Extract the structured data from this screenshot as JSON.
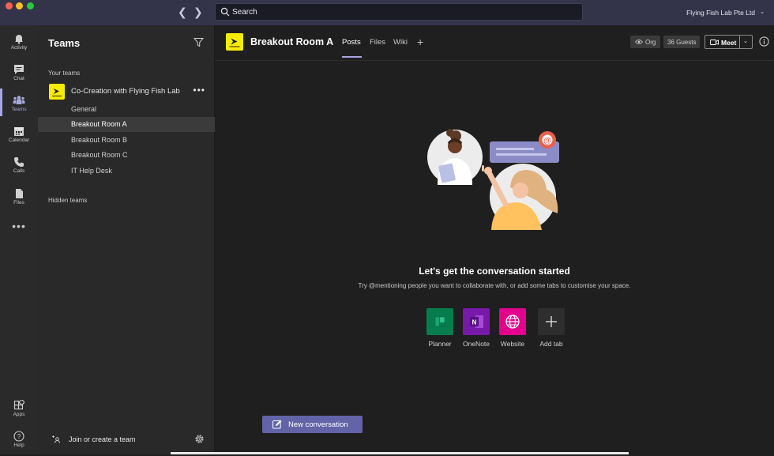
{
  "window": {
    "search_placeholder": "Search",
    "org_name": "Flying Fish Lab Pte Ltd",
    "org_chevron": "⌄"
  },
  "rail": {
    "items": [
      {
        "label": "Activity"
      },
      {
        "label": "Chat"
      },
      {
        "label": "Teams"
      },
      {
        "label": "Calendar"
      },
      {
        "label": "Calls"
      },
      {
        "label": "Files"
      },
      {
        "label": "Apps"
      },
      {
        "label": "Help"
      }
    ],
    "more": "•••"
  },
  "panel": {
    "title": "Teams",
    "your_teams_label": "Your teams",
    "team": {
      "name": "Co-Creation with Flying Fish Lab",
      "more": "•••"
    },
    "channels": [
      {
        "name": "General"
      },
      {
        "name": "Breakout Room A"
      },
      {
        "name": "Breakout Room B"
      },
      {
        "name": "Breakout Room C"
      },
      {
        "name": "IT Help Desk"
      }
    ],
    "hidden_teams_label": "Hidden teams",
    "join_label": "Join or create a team"
  },
  "header": {
    "channel_title": "Breakout Room A",
    "tabs": [
      {
        "label": "Posts"
      },
      {
        "label": "Files"
      },
      {
        "label": "Wiki"
      }
    ],
    "org_chip": "Org",
    "guests_chip": "36 Guests",
    "meet_label": "Meet",
    "meet_chevron": "⌄"
  },
  "empty_state": {
    "title": "Let's get the conversation started",
    "subtitle": "Try @mentioning people you want to collaborate with, or add some tabs to customise your space."
  },
  "apps": [
    {
      "label": "Planner",
      "color": "#077d4e"
    },
    {
      "label": "OneNote",
      "color": "#7719aa"
    },
    {
      "label": "Website",
      "color": "#e3008c"
    },
    {
      "label": "Add tab",
      "color": "#2e2e2e"
    }
  ],
  "new_conversation_label": "New conversation",
  "colors": {
    "accent": "#6264a7",
    "accent_light": "#a6a7dc",
    "team_logo": "#f8ed00"
  }
}
